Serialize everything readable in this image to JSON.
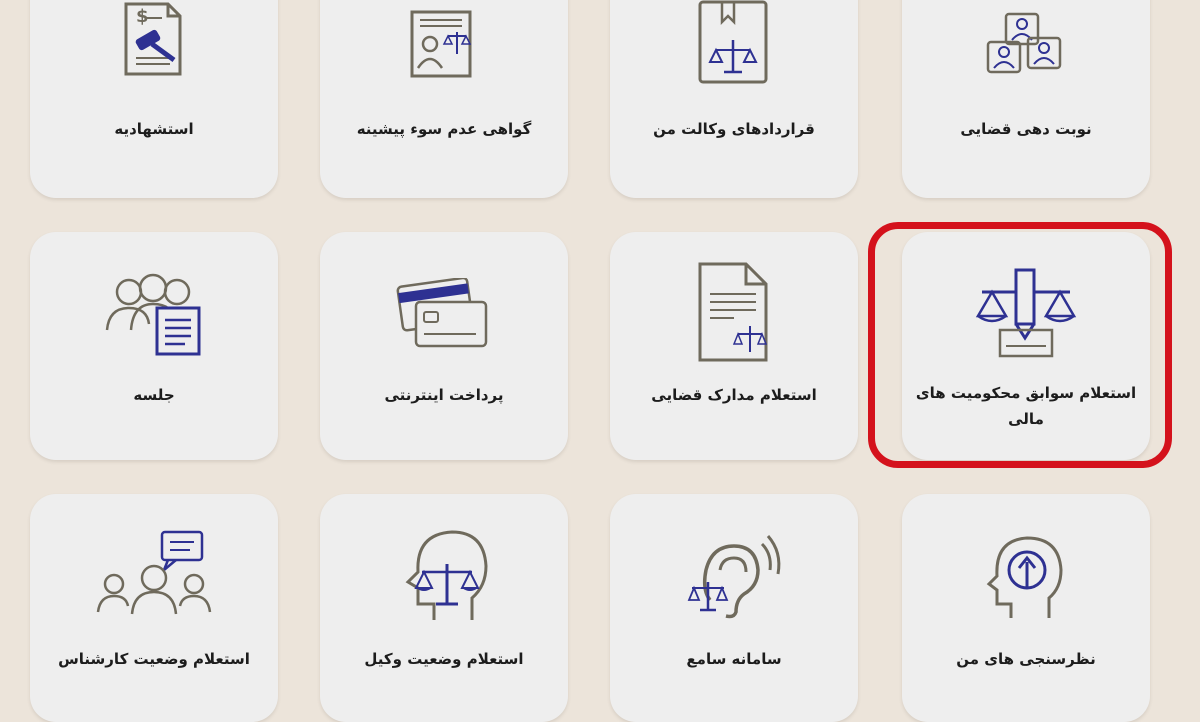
{
  "tiles_row1": [
    {
      "label": "استشهادیه",
      "icon": "gavel-document-icon"
    },
    {
      "label": "گواهی عدم سوء پیشینه",
      "icon": "criminal-record-certificate-icon"
    },
    {
      "label": "قراردادهای وکالت من",
      "icon": "power-of-attorney-contract-icon"
    },
    {
      "label": "نوبت دهی قضایی",
      "icon": "judicial-appointment-icon"
    }
  ],
  "tiles_row2": [
    {
      "label": "جلسه",
      "icon": "meeting-icon"
    },
    {
      "label": "پرداخت اینترنتی",
      "icon": "credit-card-icon"
    },
    {
      "label": "استعلام مدارک قضایی",
      "icon": "judicial-document-icon"
    },
    {
      "label": "استعلام سوابق محکومیت های مالی",
      "icon": "scales-pencil-icon",
      "highlighted": true
    }
  ],
  "tiles_row3": [
    {
      "label": "استعلام وضعیت کارشناس",
      "icon": "expert-group-icon"
    },
    {
      "label": "استعلام وضعیت وکیل",
      "icon": "lawyer-head-scales-icon"
    },
    {
      "label": "سامانه سامع",
      "icon": "hearing-ear-scales-icon"
    },
    {
      "label": "نظرسنجی های من",
      "icon": "survey-head-icon"
    }
  ],
  "colors": {
    "background": "#ece4da",
    "tile": "#eeeeee",
    "icon_gray": "#6f6a5c",
    "icon_blue": "#2e3192",
    "highlight": "#d4121c"
  }
}
